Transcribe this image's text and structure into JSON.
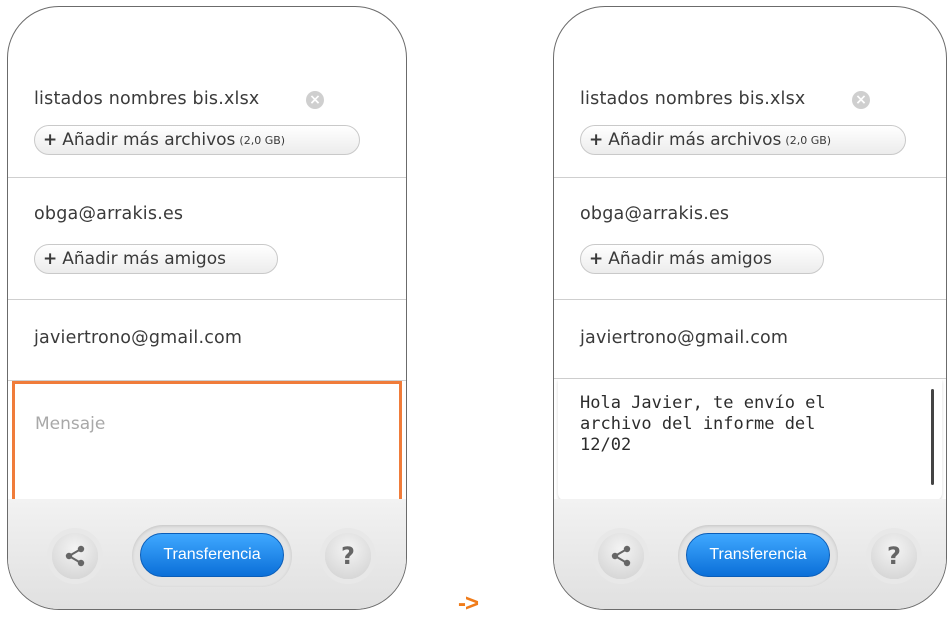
{
  "left_screen": {
    "file_name": "listados nombres bis.xlsx",
    "add_files_label": "Añadir más archivos",
    "add_files_size": "(2,0 GB)",
    "friend_email": "obga@arrakis.es",
    "add_friends_label": "Añadir más amigos",
    "sender_email": "javiertrono@gmail.com",
    "message_placeholder": "Mensaje",
    "transfer_label": "Transferencia",
    "help_label": "?"
  },
  "right_screen": {
    "file_name": "listados nombres bis.xlsx",
    "add_files_label": "Añadir más archivos",
    "add_files_size": "(2,0 GB)",
    "friend_email": "obga@arrakis.es",
    "add_friends_label": "Añadir más amigos",
    "sender_email": "javiertrono@gmail.com",
    "message_text": "Hola Javier, te envío el archivo del informe del 12/02",
    "transfer_label": "Transferencia",
    "help_label": "?"
  },
  "transition_arrow": "->",
  "colors": {
    "highlight": "#f07c3a",
    "transfer_button": "#1a82e8",
    "arrow": "#f07c1a"
  },
  "icons": [
    "remove-file-icon",
    "plus-icon",
    "share-icon",
    "help-icon"
  ]
}
